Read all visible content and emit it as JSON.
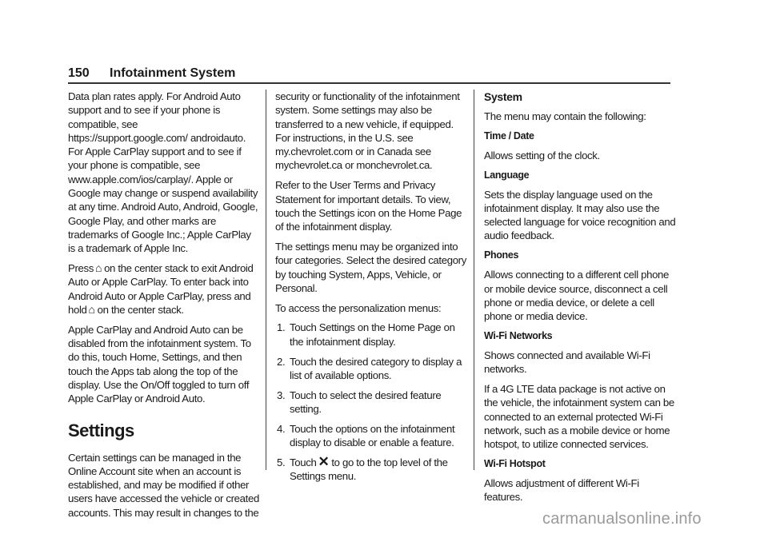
{
  "header": {
    "page_number": "150",
    "section_title": "Infotainment System"
  },
  "column1": {
    "p1": "Data plan rates apply. For Android Auto support and to see if your phone is compatible, see https://support.google.com/ androidauto. For Apple CarPlay support and to see if your phone is compatible, see www.apple.com/ios/carplay/. Apple or Google may change or suspend availability at any time. Android Auto, Android, Google, Google Play, and other marks are trademarks of Google Inc.; Apple CarPlay is a trademark of Apple Inc.",
    "p2_a": "Press",
    "p2_b": "on the center stack to exit Android Auto or Apple CarPlay. To enter back into Android Auto or Apple CarPlay, press and hold",
    "p2_c": "on the center stack.",
    "p3": "Apple CarPlay and Android Auto can be disabled from the infotainment system. To do this, touch Home, Settings, and then touch the Apps tab along the top of the display. Use the On/Off toggled to turn off Apple CarPlay or Android Auto.",
    "heading": "Settings",
    "p4": "Certain settings can be managed in the Online Account site when an account is established, and may be modified if other users have accessed the vehicle or created accounts. This may result in changes to the"
  },
  "column2": {
    "p1": "security or functionality of the infotainment system. Some settings may also be transferred to a new vehicle, if equipped. For instructions, in the U.S. see my.chevrolet.com or in Canada see mychevrolet.ca or monchevrolet.ca.",
    "p2": "Refer to the User Terms and Privacy Statement for important details. To view, touch the Settings icon on the Home Page of the infotainment display.",
    "p3": "The settings menu may be organized into four categories. Select the desired category by touching System, Apps, Vehicle, or Personal.",
    "p4": "To access the personalization menus:",
    "steps": [
      {
        "num": "1.",
        "text": "Touch Settings on the Home Page on the infotainment display."
      },
      {
        "num": "2.",
        "text": "Touch the desired category to display a list of available options."
      },
      {
        "num": "3.",
        "text": "Touch to select the desired feature setting."
      },
      {
        "num": "4.",
        "text": "Touch the options on the infotainment display to disable or enable a feature."
      },
      {
        "num": "5.",
        "text_a": "Touch",
        "text_b": "to go to the top level of the Settings menu."
      }
    ]
  },
  "column3": {
    "heading": "System",
    "intro": "The menu may contain the following:",
    "items": [
      {
        "title": "Time / Date",
        "desc": "Allows setting of the clock."
      },
      {
        "title": "Language",
        "desc": "Sets the display language used on the infotainment display. It may also use the selected language for voice recognition and audio feedback."
      },
      {
        "title": "Phones",
        "desc": "Allows connecting to a different cell phone or mobile device source, disconnect a cell phone or media device, or delete a cell phone or media device."
      },
      {
        "title": "Wi-Fi Networks",
        "desc": "Shows connected and available Wi-Fi networks.",
        "desc2": "If a 4G LTE data package is not active on the vehicle, the infotainment system can be connected to an external protected Wi-Fi network, such as a mobile device or home hotspot, to utilize connected services."
      },
      {
        "title": "Wi-Fi Hotspot",
        "desc": "Allows adjustment of different Wi-Fi features."
      }
    ]
  },
  "icons": {
    "home": "⌂",
    "close": "✕"
  },
  "watermark": "carmanualsonline.info"
}
